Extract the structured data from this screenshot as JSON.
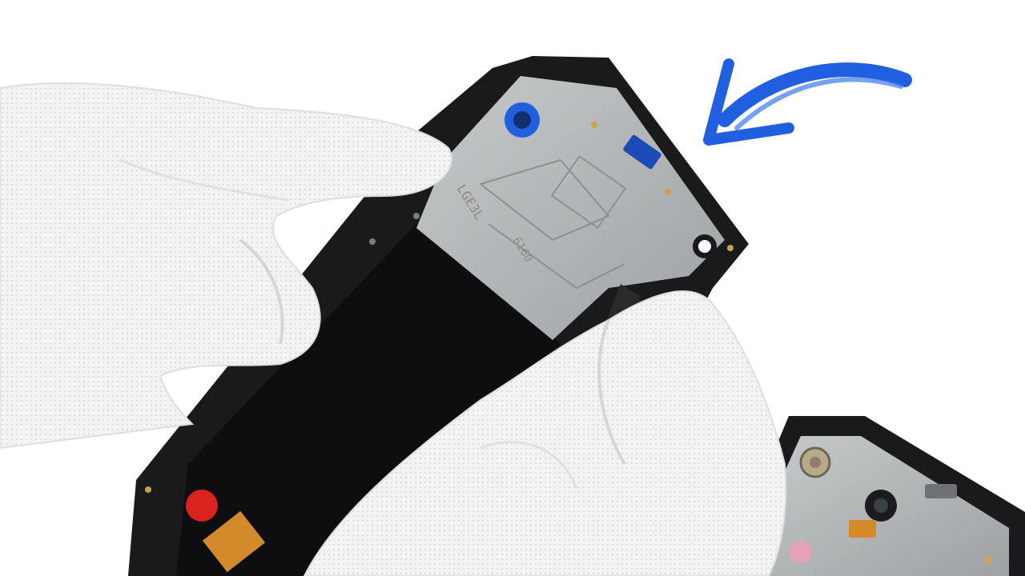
{
  "scene": {
    "background": "#ffffff",
    "colors": {
      "glove": "#f2f2f0",
      "glove_shadow": "#d9d9d6",
      "frame": "#1a1a1c",
      "midplate": "#b9bcbd",
      "display": "#0e0e10",
      "arrow": "#1f5fe0",
      "flex": "#d28a2a",
      "sticker": "#d8231f"
    },
    "objects": [
      "gloved-left-hand",
      "gloved-right-hand",
      "phone-front-frame",
      "black-pry-tool",
      "second-phone-frame",
      "blue-arrow"
    ],
    "stamped_text": {
      "lot_code": "LGE3L",
      "small_code": "6160"
    }
  }
}
